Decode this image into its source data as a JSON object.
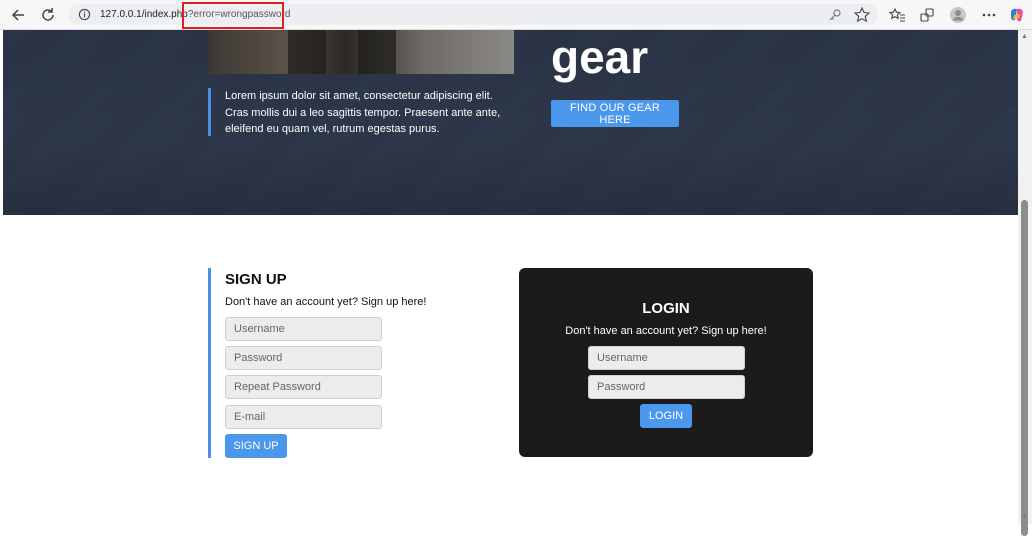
{
  "browser": {
    "url_host": "127.0.0.1/index.php",
    "url_query": "?error=wrongpassword",
    "icons": [
      "back-arrow-icon",
      "reload-icon",
      "info-icon",
      "key-icon",
      "star-icon",
      "favorites-icon",
      "extensions-icon",
      "profile-icon",
      "more-icon",
      "copilot-icon"
    ]
  },
  "hero": {
    "heading": "gear",
    "quote": "Lorem ipsum dolor sit amet, consectetur adipiscing elit. Cras mollis dui a leo sagittis tempor. Praesent ante ante, eleifend eu quam vel, rutrum egestas purus.",
    "button_label": "FIND OUR GEAR HERE",
    "accent_color": "#4a97ec"
  },
  "signup": {
    "title": "SIGN UP",
    "subtitle": "Don't have an account yet? Sign up here!",
    "fields": [
      {
        "placeholder": "Username"
      },
      {
        "placeholder": "Password"
      },
      {
        "placeholder": "Repeat Password"
      },
      {
        "placeholder": "E-mail"
      }
    ],
    "button_label": "SIGN UP"
  },
  "login": {
    "title": "LOGIN",
    "subtitle": "Don't have an account yet? Sign up here!",
    "fields": [
      {
        "placeholder": "Username"
      },
      {
        "placeholder": "Password"
      }
    ],
    "button_label": "LOGIN"
  }
}
